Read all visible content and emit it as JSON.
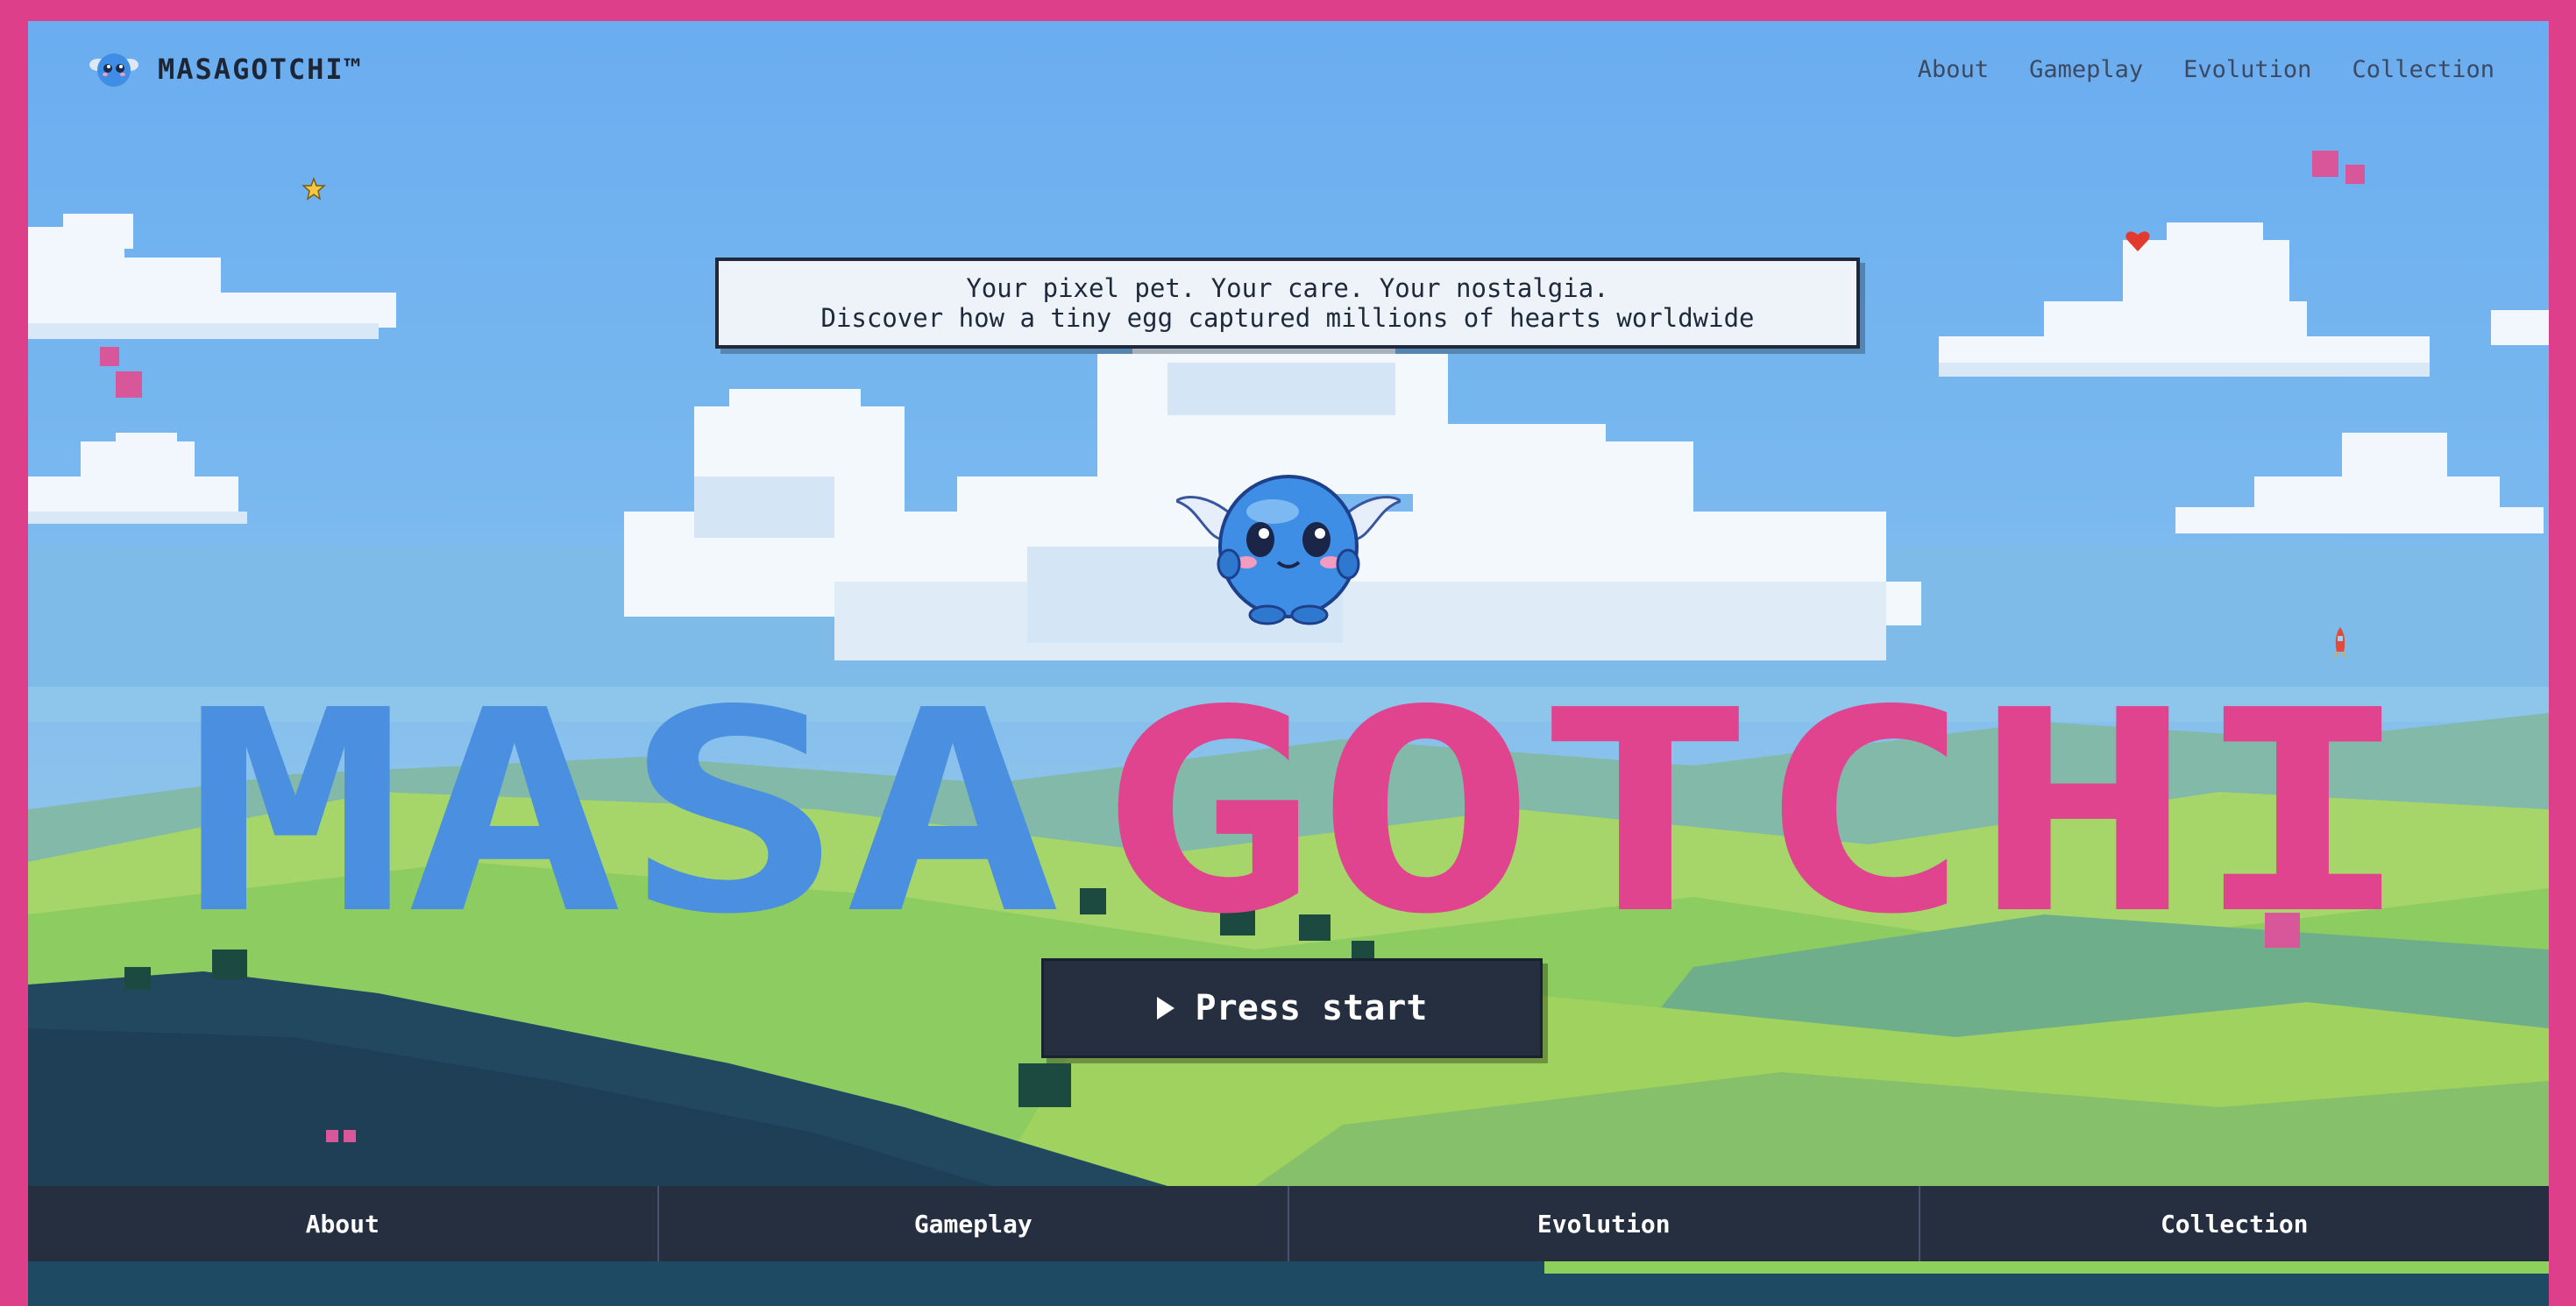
{
  "brand": {
    "name": "MASAGOTCHI™",
    "logo_icon": "blue-pet-icon"
  },
  "nav": {
    "links": [
      "About",
      "Gameplay",
      "Evolution",
      "Collection"
    ]
  },
  "hero": {
    "tagline_line1": "Your pixel pet. Your care. Your nostalgia.",
    "tagline_line2": "Discover how a tiny egg captured millions of hearts worldwide",
    "title_part1": "MASA",
    "title_part2": "GOTCHI",
    "cta_label": "Press start",
    "cta_icon": "play-triangle-icon",
    "mascot_icon": "winged-blue-blob-pet"
  },
  "bottom_nav": {
    "items": [
      "About",
      "Gameplay",
      "Evolution",
      "Collection"
    ]
  },
  "decor": {
    "icons": [
      "star-icon",
      "heart-icon",
      "rocket-icon",
      "pink-pixel-squares"
    ]
  },
  "colors": {
    "frame": "#de3f8a",
    "sky": "#6fb0ee",
    "title_blue": "#4a8fe0",
    "title_pink": "#e0448f",
    "dark_panel": "#252f40"
  }
}
